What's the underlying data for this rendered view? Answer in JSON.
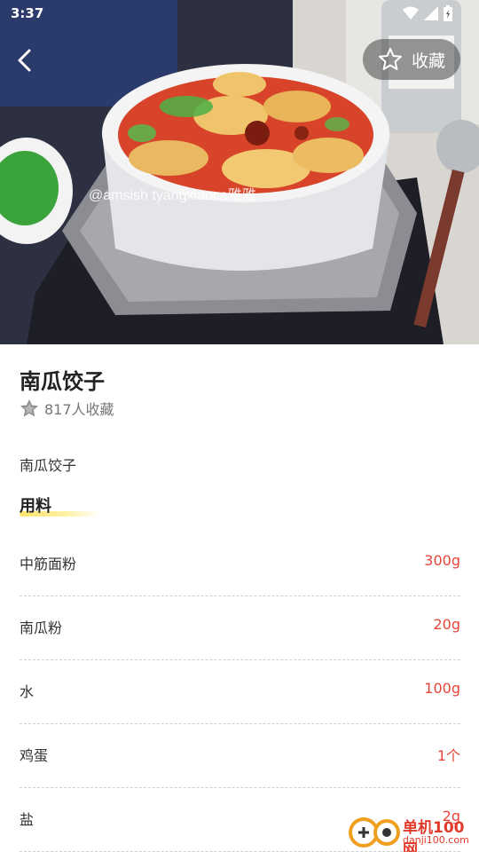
{
  "status_bar": {
    "time": "3:37"
  },
  "header": {
    "favorite_label": "收藏"
  },
  "hero": {
    "photo_watermark": "@amsish tyangxiaoca雅雅"
  },
  "recipe": {
    "title": "南瓜饺子",
    "favorite_count_text": "817人收藏",
    "description": "南瓜饺子"
  },
  "ingredients_section": {
    "heading": "用料",
    "items": [
      {
        "name": "中筋面粉",
        "amount": "300g"
      },
      {
        "name": "南瓜粉",
        "amount": "20g"
      },
      {
        "name": "水",
        "amount": "100g"
      },
      {
        "name": "鸡蛋",
        "amount": "1个"
      },
      {
        "name": "盐",
        "amount": "2g"
      }
    ]
  },
  "watermark": {
    "site_name": "单机100网",
    "site_url": "danji100.com"
  },
  "colors": {
    "amount_red": "#e8443a",
    "underline_yellow": "#ffe36b",
    "watermark_red": "#e23a2a"
  },
  "icons": {
    "back": "chevron-left-icon",
    "favorite": "star-outline-icon",
    "favorite_count": "star-badge-icon",
    "wifi": "wifi-icon",
    "signal": "signal-icon",
    "battery": "battery-icon"
  }
}
